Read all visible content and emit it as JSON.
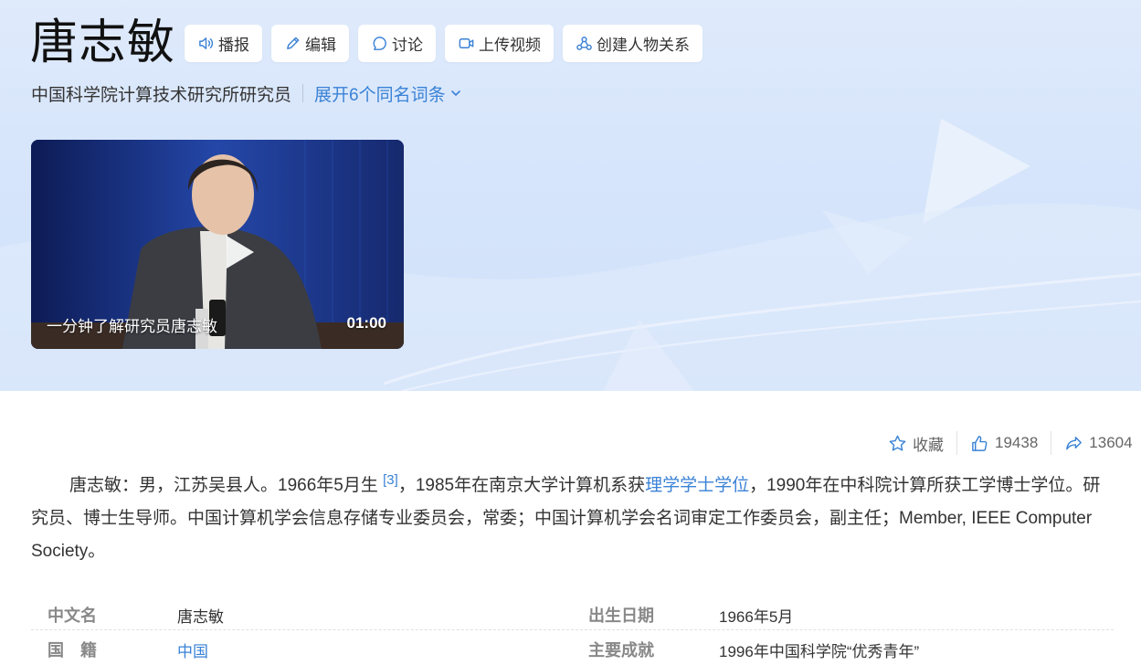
{
  "header": {
    "title": "唐志敏",
    "subtitle": "中国科学院计算技术研究所研究员",
    "expand_label": "展开6个同名词条",
    "actions": [
      {
        "label": "播报",
        "icon": "speaker-icon"
      },
      {
        "label": "编辑",
        "icon": "pencil-icon"
      },
      {
        "label": "讨论",
        "icon": "chat-bubble-icon"
      },
      {
        "label": "上传视频",
        "icon": "video-camera-icon"
      },
      {
        "label": "创建人物关系",
        "icon": "relation-icon"
      }
    ]
  },
  "video": {
    "caption": "一分钟了解研究员唐志敏",
    "duration": "01:00"
  },
  "stats": {
    "favorite_label": "收藏",
    "likes": "19438",
    "shares": "13604"
  },
  "summary": {
    "part1": "唐志敏：男，江苏吴县人。1966年5月生",
    "ref": "[3]",
    "part2": "，1985年在南京大学计算机系获",
    "link": "理学学士学位",
    "part3": "，1990年在中科院计算所获工学博士学位。研究员、博士生导师。中国计算机学会信息存储专业委员会，常委；中国计算机学会名词审定工作委员会，副主任；Member, IEEE Computer Society。"
  },
  "info": [
    {
      "key1": "中文名",
      "val1": "唐志敏",
      "key2": "出生日期",
      "val2": "1966年5月"
    },
    {
      "key1": "国　籍",
      "val1": "中国",
      "key2": "主要成就",
      "val2": "1996年中国科学院“优秀青年”"
    }
  ],
  "colors": {
    "accent": "#3a82d6",
    "hero_bg": "#d6e5fb"
  }
}
